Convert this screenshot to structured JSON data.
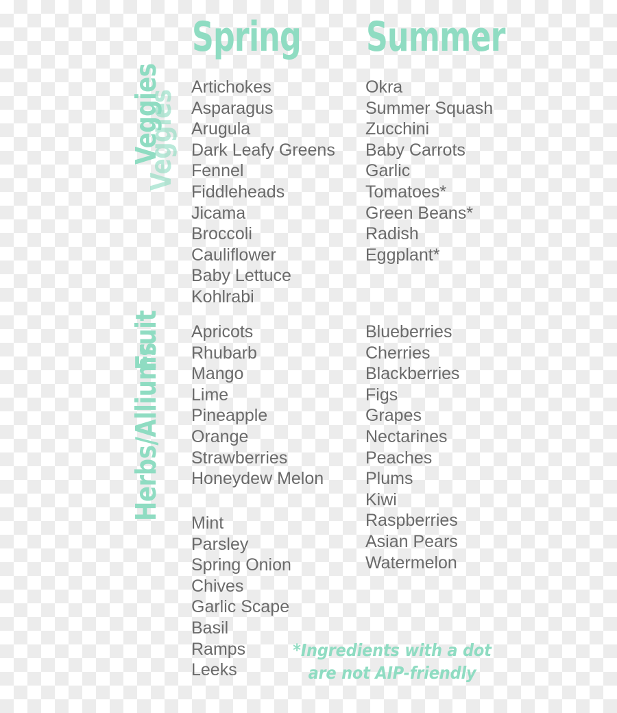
{
  "colors": {
    "accent_mint": "#8fdcc2",
    "body_gray": "#6a6a6a",
    "checker_light": "#ffffff",
    "checker_dark": "#ececec"
  },
  "headers": {
    "spring": "Spring",
    "summer": "Summer"
  },
  "categories": {
    "veggies": "Veggies",
    "fruit": "Fruit",
    "herbs": "Herbs/Alliums"
  },
  "lists": {
    "spring_veggies": [
      "Artichokes",
      "Asparagus",
      "Arugula",
      "Dark Leafy Greens",
      "Fennel",
      "Fiddleheads",
      "Jicama",
      "Broccoli",
      "Cauliflower",
      "Baby Lettuce",
      "Kohlrabi"
    ],
    "summer_veggies": [
      "Okra",
      "Summer Squash",
      "Zucchini",
      "Baby Carrots",
      "Garlic",
      "Tomatoes*",
      "Green Beans*",
      "Radish",
      "Eggplant*"
    ],
    "spring_fruit": [
      "Apricots",
      "Rhubarb",
      "Mango",
      "Lime",
      "Pineapple",
      "Orange",
      "Strawberries",
      "Honeydew Melon"
    ],
    "summer_fruit": [
      "Blueberries",
      "Cherries",
      "Blackberries",
      "Figs",
      "Grapes",
      "Nectarines",
      "Peaches",
      "Plums",
      "Kiwi",
      "Raspberries",
      "Asian Pears",
      "Watermelon"
    ],
    "spring_herbs": [
      "Mint",
      "Parsley",
      "Spring Onion",
      "Chives",
      "Garlic Scape",
      "Basil",
      "Ramps",
      "Leeks"
    ]
  },
  "footnote": {
    "line1": "*Ingredients with a dot",
    "line2": "are not AIP-friendly"
  }
}
